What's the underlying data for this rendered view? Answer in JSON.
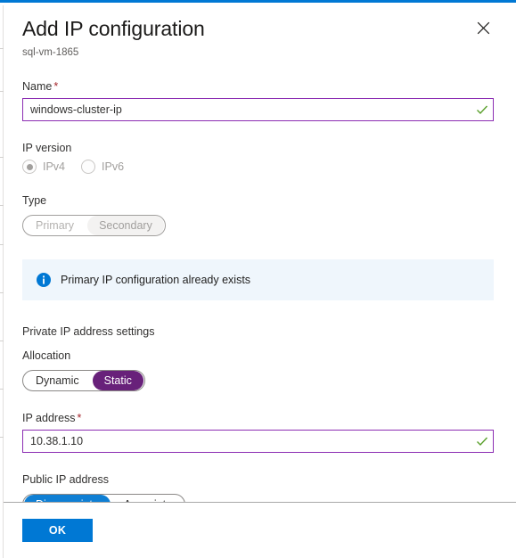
{
  "blade": {
    "accent_top_color": "#0078d4",
    "header": {
      "title": "Add IP configuration",
      "subtitle": "sql-vm-1865",
      "close_icon": "close-icon",
      "close_tooltip": "Close"
    },
    "fields": {
      "name": {
        "label": "Name",
        "required_marker": "*",
        "value": "windows-cluster-ip",
        "placeholder": "",
        "validation_icon": "checkmark-icon",
        "border_color": "#8c2db3",
        "valid_color": "#5aa02c"
      },
      "ip_version": {
        "label": "IP version",
        "disabled": true,
        "options": [
          {
            "label": "IPv4",
            "selected": true
          },
          {
            "label": "IPv6",
            "selected": false
          }
        ]
      },
      "type": {
        "label": "Type",
        "disabled": true,
        "options": [
          {
            "label": "Primary",
            "selected": false
          },
          {
            "label": "Secondary",
            "selected": true
          }
        ]
      },
      "private_ip_section": {
        "heading": "Private IP address settings",
        "allocation": {
          "label": "Allocation",
          "options": [
            {
              "label": "Dynamic",
              "selected": false
            },
            {
              "label": "Static",
              "selected": true
            }
          ],
          "selected_color": "#68217a"
        },
        "ip_address": {
          "label": "IP address",
          "required_marker": "*",
          "value": "10.38.1.10",
          "placeholder": "",
          "validation_icon": "checkmark-icon",
          "border_color": "#8c2db3"
        }
      },
      "public_ip": {
        "label": "Public IP address",
        "options": [
          {
            "label": "Disassociate",
            "selected": true
          },
          {
            "label": "Associate",
            "selected": false
          }
        ],
        "selected_color": "#0f7fd4"
      }
    },
    "info_banner": {
      "icon": "info-icon",
      "text": "Primary IP configuration already exists",
      "background": "#eff6fc",
      "icon_color": "#0078d4"
    },
    "footer": {
      "ok_label": "OK",
      "ok_color": "#0078d4"
    }
  }
}
